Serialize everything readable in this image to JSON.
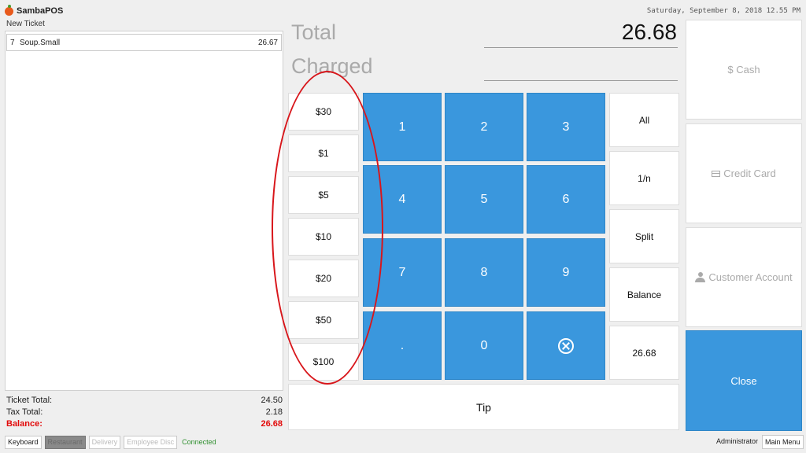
{
  "app": {
    "name": "SambaPOS"
  },
  "datetime": "Saturday, September 8, 2018 12.55 PM",
  "ticket": {
    "name": "New Ticket",
    "orders": [
      {
        "qty": "7",
        "name": "Soup.Small",
        "price": "26.67"
      }
    ],
    "ticket_total_label": "Ticket Total:",
    "ticket_total_value": "24.50",
    "tax_total_label": "Tax Total:",
    "tax_total_value": "2.18",
    "balance_label": "Balance:",
    "balance_value": "26.68"
  },
  "payment": {
    "total_label": "Total",
    "total_value": "26.68",
    "charged_label": "Charged",
    "charged_value": ""
  },
  "quick_amounts": [
    "$30",
    "$1",
    "$5",
    "$10",
    "$20",
    "$50",
    "$100"
  ],
  "numpad": [
    "1",
    "2",
    "3",
    "4",
    "5",
    "6",
    "7",
    "8",
    "9",
    ".",
    "0"
  ],
  "options": [
    "All",
    "1/n",
    "Split",
    "Balance",
    "26.68"
  ],
  "tip_label": "Tip",
  "payment_types": {
    "cash": "$ Cash",
    "credit_card": "Credit Card",
    "customer_account": "Customer Account"
  },
  "close_label": "Close",
  "bottom_bar": {
    "keyboard": "Keyboard",
    "restaurant": "Restaurant",
    "delivery": "Delivery",
    "employee_disc": "Employee Disc",
    "status": "Connected",
    "user": "Administrator",
    "main_menu": "Main Menu"
  },
  "colors": {
    "accent": "#3a97dd",
    "balance": "#e20a0a",
    "connected": "#2f8f2f",
    "annotation": "#d8161b",
    "logo": "#e85a1c"
  }
}
